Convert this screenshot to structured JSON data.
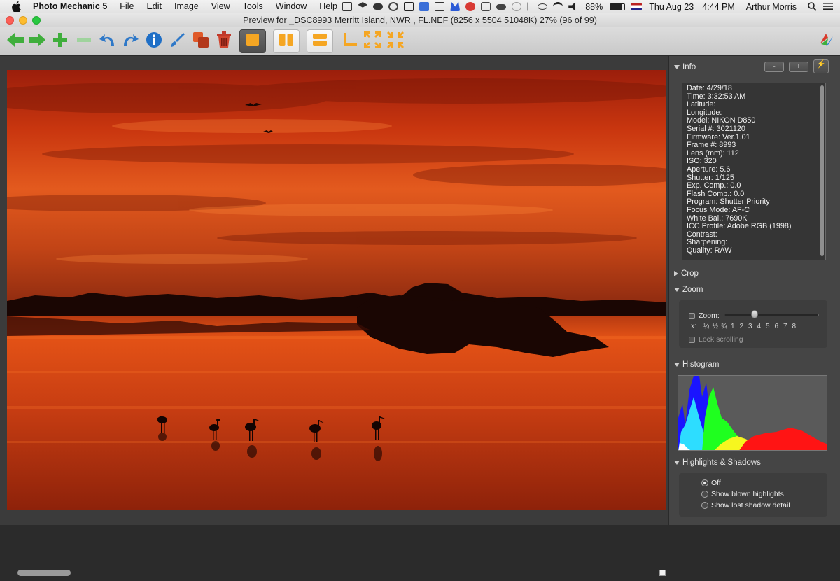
{
  "menubar": {
    "app_name": "Photo Mechanic 5",
    "items": [
      "File",
      "Edit",
      "Image",
      "View",
      "Tools",
      "Window",
      "Help"
    ],
    "status": {
      "battery": "88%",
      "date": "Thu Aug 23",
      "time": "4:44 PM",
      "user": "Arthur Morris"
    }
  },
  "window": {
    "title": "Preview for _DSC8993 Merritt Island, NWR , FL.NEF (8256 x 5504 51048K) 27% (96 of 99)"
  },
  "toolbar": {
    "buttons": [
      "previous-arrow",
      "next-arrow",
      "add-plus",
      "remove-minus",
      "rotate-left",
      "rotate-right",
      "info",
      "edit-brush",
      "copy-overlay",
      "delete-trash",
      "single-view",
      "side-by-side",
      "top-bottom",
      "crop-corner",
      "compare-shrink",
      "compare-expand"
    ]
  },
  "panel": {
    "info": {
      "title": "Info",
      "buttons": {
        "minus": "-",
        "plus": "+",
        "bolt": "⚡"
      },
      "lines": [
        "Date: 4/29/18",
        "Time: 3:32:53 AM",
        "Latitude:",
        "Longitude:",
        "Model: NIKON D850",
        "Serial #: 3021120",
        "Firmware: Ver.1.01",
        "Frame #: 8993",
        "Lens (mm): 112",
        "ISO: 320",
        "Aperture: 5.6",
        "Shutter: 1/125",
        "Exp. Comp.: 0.0",
        "Flash Comp.: 0.0",
        "Program: Shutter Priority",
        "Focus Mode: AF-C",
        "White Bal.: 7690K",
        "ICC Profile: Adobe RGB (1998)",
        "Contrast:",
        "Sharpening:",
        "Quality: RAW"
      ]
    },
    "crop": {
      "title": "Crop"
    },
    "zoom": {
      "title": "Zoom",
      "checkbox_label": "Zoom:",
      "scale_prefix": "x:",
      "scale": [
        "¼",
        "½",
        "¾",
        "1",
        "2",
        "3",
        "4",
        "5",
        "6",
        "7",
        "8"
      ],
      "slider_position": 0.32,
      "lock_label": "Lock scrolling"
    },
    "histogram": {
      "title": "Histogram"
    },
    "highlights": {
      "title": "Highlights & Shadows",
      "options": [
        "Off",
        "Show blown highlights",
        "Show lost shadow detail"
      ],
      "selected": "Off"
    }
  },
  "colors": {
    "sunset_orange": "#e2501a",
    "panel_bg": "#454545",
    "toolbar_accent": "#f5a623"
  }
}
